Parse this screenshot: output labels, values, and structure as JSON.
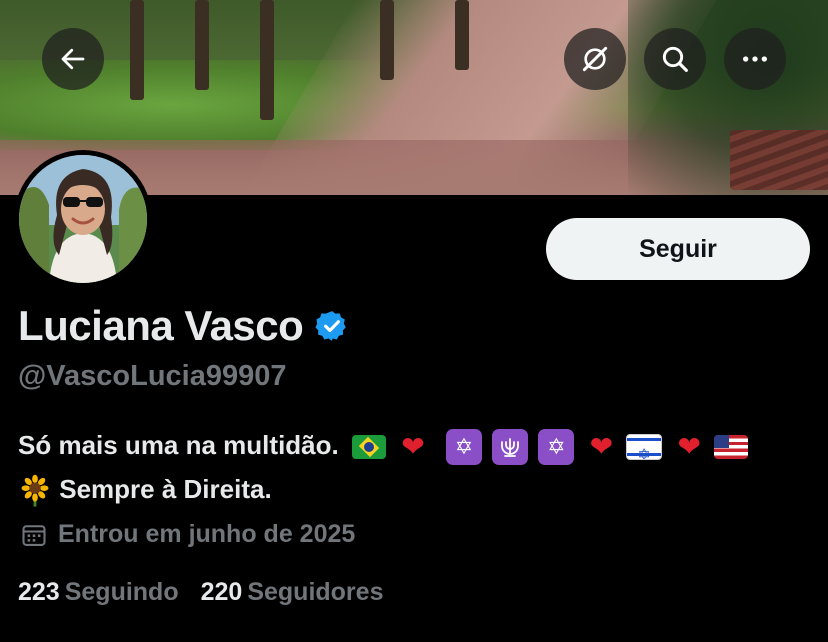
{
  "header": {
    "back_icon": "arrow-left-icon",
    "grok_icon": "grok-icon",
    "search_icon": "search-icon",
    "more_icon": "more-horizontal-icon"
  },
  "profile": {
    "follow_label": "Seguir",
    "name": "Luciana Vasco",
    "verified_icon": "verified-badge-icon",
    "handle": "@VascoLucia99907",
    "bio_line1_text": "Só mais uma na multidão.",
    "bio_line2_text": "Sempre à Direita.",
    "joined_icon": "calendar-icon",
    "joined_text": "Entrou em junho de 2025",
    "following_count": "223",
    "following_label": "Seguindo",
    "followers_count": "220",
    "followers_label": "Seguidores"
  },
  "colors": {
    "background": "#000000",
    "text_primary": "#e7e9ea",
    "text_secondary": "#71767b",
    "verified_blue": "#1d9bf0",
    "follow_bg": "#eff3f4"
  }
}
